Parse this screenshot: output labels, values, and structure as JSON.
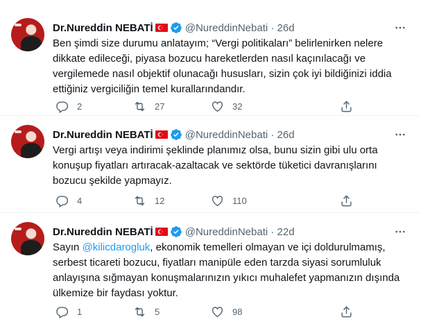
{
  "tweets": [
    {
      "name": "Dr.Nureddin NEBATİ",
      "handle": "@NureddinNebati",
      "time": "26d",
      "text": "Ben şimdi size durumu anlatayım; “Vergi politikaları” belirlenirken nelere dikkate edileceği, piyasa bozucu hareketlerden nasıl kaçınılacağı ve vergilemede nasıl objektif olunacağı hususları, sizin çok iyi bildiğinizi iddia ettiğiniz vergiciliğin temel kurallarındandır.",
      "replies": "2",
      "retweets": "27",
      "likes": "32"
    },
    {
      "name": "Dr.Nureddin NEBATİ",
      "handle": "@NureddinNebati",
      "time": "26d",
      "text": "Vergi artışı veya indirimi şeklinde planımız olsa, bunu sizin gibi ulu orta konuşup fiyatları artıracak-azaltacak ve sektörde tüketici davranışlarını bozucu şekilde yapmayız.",
      "replies": "4",
      "retweets": "12",
      "likes": "110"
    },
    {
      "name": "Dr.Nureddin NEBATİ",
      "handle": "@NureddinNebati",
      "time": "22d",
      "text_prefix": "Sayın ",
      "mention": "@kilicdarogluk",
      "text_suffix": ", ekonomik temelleri olmayan ve içi doldurulmamış, serbest ticareti bozucu, fiyatları manipüle eden tarzda siyasi sorumluluk anlayışına sığmayan konuşmalarınızın yıkıcı muhalefet yapmanızın dışında ülkemize bir faydası yoktur.",
      "replies": "1",
      "retweets": "5",
      "likes": "98"
    }
  ],
  "separator": " · ",
  "icons": {
    "more": "more-dots-icon",
    "flag": "turkey-flag-icon",
    "verified": "verified-badge-icon",
    "reply": "reply-icon",
    "retweet": "retweet-icon",
    "like": "heart-icon",
    "share": "share-icon"
  },
  "colors": {
    "text": "#0f1419",
    "secondary": "#536471",
    "accent": "#1d9bf0",
    "flag_red": "#e30a17"
  }
}
